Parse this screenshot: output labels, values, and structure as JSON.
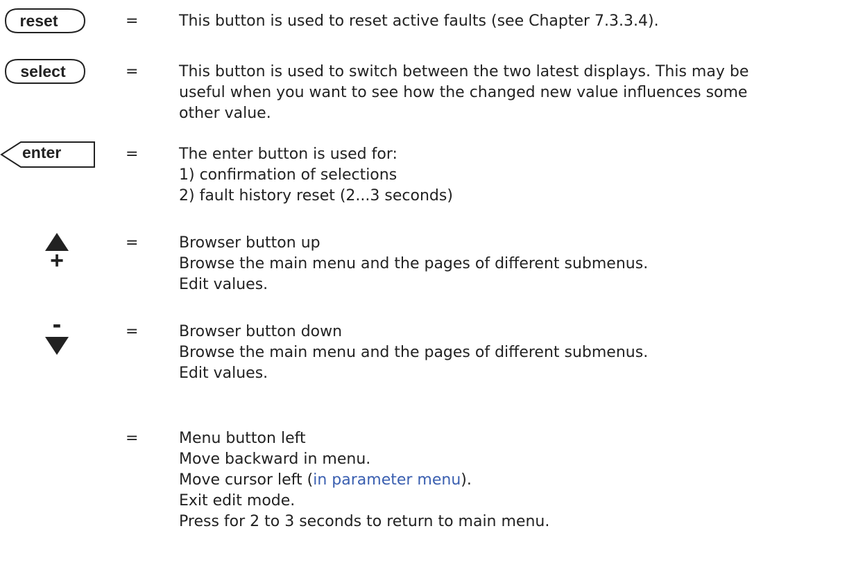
{
  "equals": "=",
  "reset": {
    "label": "reset",
    "desc": "This button is used to reset active faults (see Chapter 7.3.3.4)."
  },
  "select": {
    "label": "select",
    "desc_lines": [
      "This button is used to switch between the two latest displays. This may be",
      "useful when you want to see how the changed new value influences some",
      "other value."
    ]
  },
  "enter": {
    "label": "enter",
    "desc_lines": [
      "The enter button is used for:",
      "1) confirmation of selections",
      "2) fault history reset (2...3 seconds)"
    ]
  },
  "up": {
    "plus": "+",
    "desc_lines": [
      "Browser button up",
      "Browse the main menu and the pages of different submenus.",
      "Edit values."
    ]
  },
  "down": {
    "minus": "-",
    "desc_lines": [
      "Browser button down",
      "Browse the main menu and the pages of different submenus.",
      "Edit values."
    ]
  },
  "left": {
    "line1": "Menu button left",
    "line2": "Move backward in menu.",
    "line3_pre": "Move cursor left (",
    "line3_link": "in parameter menu",
    "line3_post": ").",
    "line4": "Exit edit mode.",
    "line5": "Press for 2 to 3 seconds to return to main menu."
  }
}
